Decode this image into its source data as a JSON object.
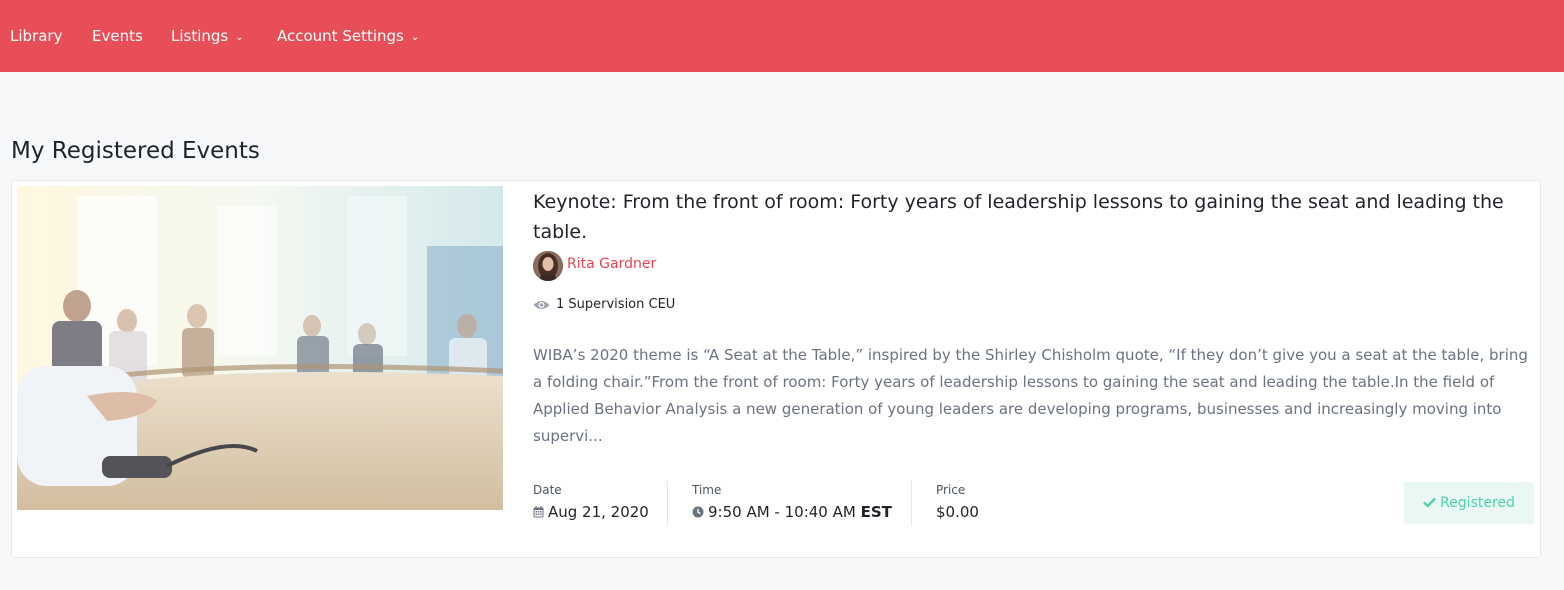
{
  "nav": {
    "items": [
      {
        "label": "Library"
      },
      {
        "label": "Events"
      },
      {
        "label": "Listings"
      },
      {
        "label": "Account Settings"
      }
    ]
  },
  "page": {
    "title": "My Registered Events"
  },
  "event": {
    "title": "Keynote: From the front of room: Forty years of leadership lessons to gaining the seat and leading the table.",
    "speaker": "Rita Gardner",
    "ceu": "1 Supervision CEU",
    "description": "WIBA’s 2020 theme is “A Seat at the Table,” inspired by the Shirley Chisholm quote, “If they don’t give you a seat at the table, bring a folding chair.”From the front of room: Forty years of leadership lessons to gaining the seat and leading the table.In the field of Applied Behavior Analysis a new generation of young leaders are developing programs, businesses and increasingly moving into supervi...",
    "date_label": "Date",
    "date": "Aug 21, 2020",
    "time_label": "Time",
    "time": "9:50 AM - 10:40 AM",
    "timezone": "EST",
    "price_label": "Price",
    "price": "$0.00",
    "status": "Registered"
  },
  "icons": {
    "listings_caret": "chevron-down-icon",
    "account_caret": "chevron-down-icon",
    "ceu": "eye-icon",
    "date": "calendar-icon",
    "time": "clock-icon",
    "status": "check-icon"
  },
  "colors": {
    "nav_bg": "#e84e58",
    "speaker": "#e8434f",
    "registered_text": "#4fd1b4",
    "registered_bg": "#eaf8f4"
  }
}
